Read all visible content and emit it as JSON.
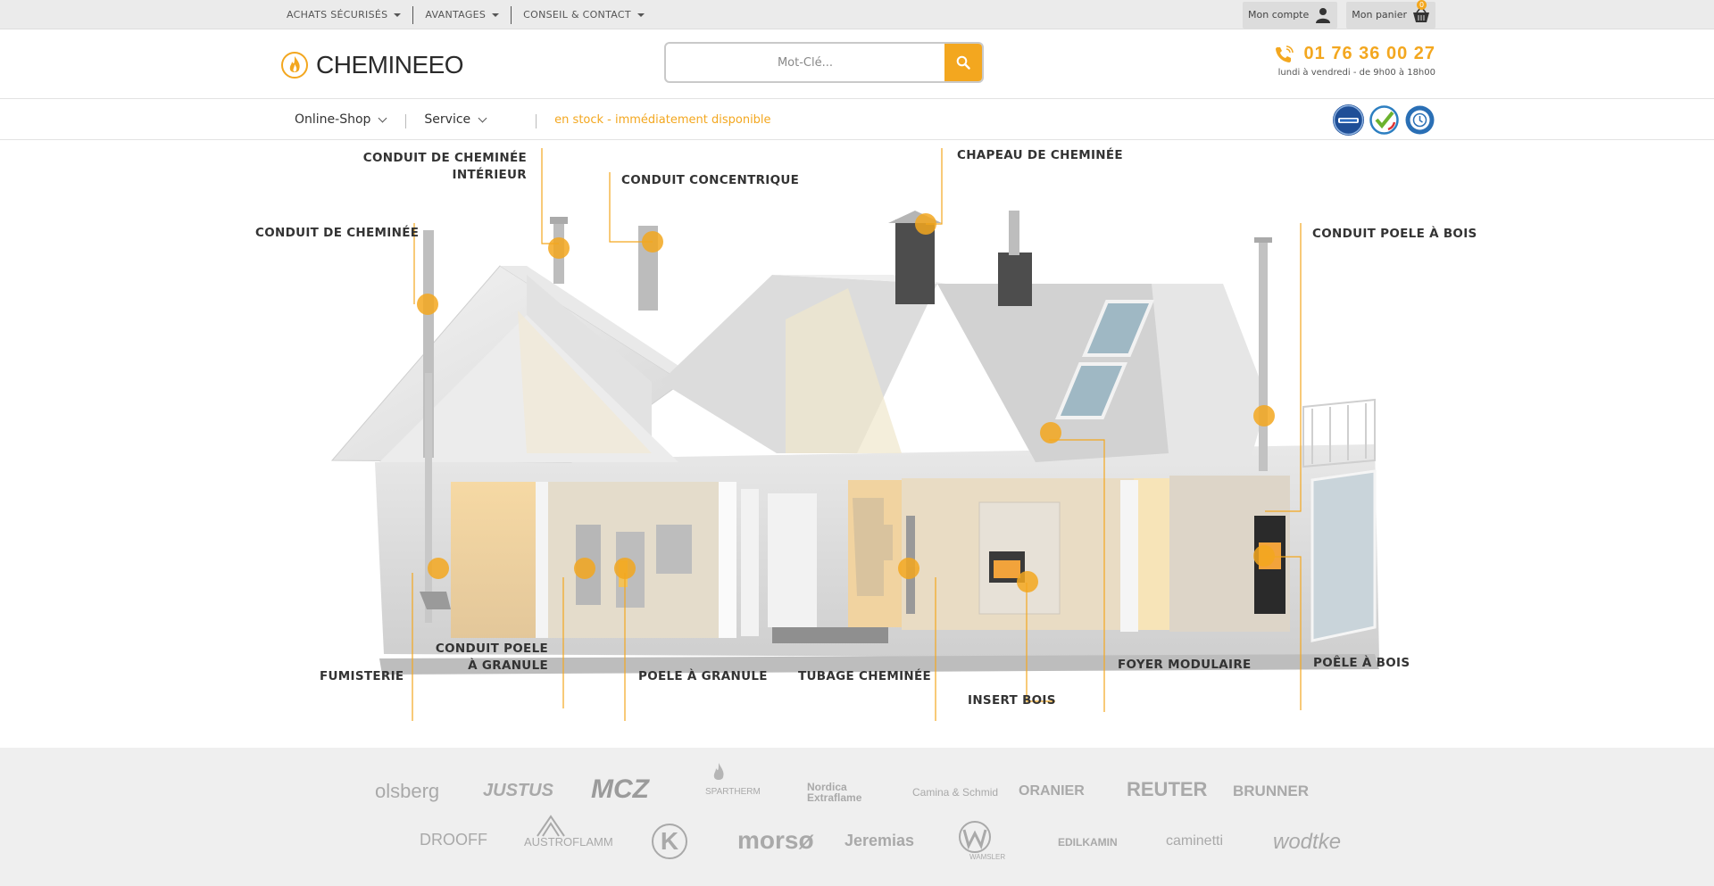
{
  "topbar": {
    "nav": [
      {
        "label": "ACHATS SÉCURISÉS"
      },
      {
        "label": "AVANTAGES"
      },
      {
        "label": "CONSEIL & CONTACT"
      }
    ],
    "account_label": "Mon compte",
    "cart_label": "Mon panier",
    "cart_count": "0"
  },
  "header": {
    "logo_text": "CHEMINEEO",
    "search": {
      "placeholder": "Mot-Clé..."
    },
    "phone": {
      "number": "01 76 36 00 27",
      "hours": "lundi à vendredi - de 9h00 à 18h00"
    }
  },
  "mainnav": {
    "items": [
      {
        "label": "Online-Shop"
      },
      {
        "label": "Service"
      }
    ],
    "stock_text": "en stock - immédiatement disponible",
    "badges": [
      "idealo",
      "trusted",
      "check"
    ]
  },
  "hero": {
    "labels": {
      "conduit_cheminee_interieur_1": "CONDUIT DE CHEMINÉE",
      "conduit_cheminee_interieur_2": "INTÉRIEUR",
      "conduit_concentrique": "CONDUIT CONCENTRIQUE",
      "chapeau_cheminee": "CHAPEAU DE CHEMINÉE",
      "conduit_cheminee": "CONDUIT DE CHEMINÉE",
      "conduit_poele_bois": "CONDUIT POELE À BOIS",
      "fumisterie": "FUMISTERIE",
      "conduit_poele_granule_1": "CONDUIT POELE",
      "conduit_poele_granule_2": "À GRANULE",
      "poele_granule": "POELE À GRANULE",
      "tubage_cheminee": "TUBAGE CHEMINÉE",
      "insert_bois": "INSERT BOIS",
      "foyer_modulaire": "FOYER MODULAIRE",
      "poele_bois": "POÊLE À BOIS"
    },
    "accent_color": "#f3a71f"
  },
  "brands": {
    "row1": [
      "olsberg",
      "JUSTUS",
      "MCZ",
      "SPARTHERM",
      "Nordica Extraflame",
      "Camina & Schmid",
      "ORANIER",
      "REUTER",
      "BRUNNER"
    ],
    "row2": [
      "DROOFF",
      "AUSTROFLAMM",
      "K",
      "morsø",
      "Jeremias",
      "WAMSLER",
      "EDILKAMIN",
      "caminetti",
      "wodtke"
    ]
  }
}
